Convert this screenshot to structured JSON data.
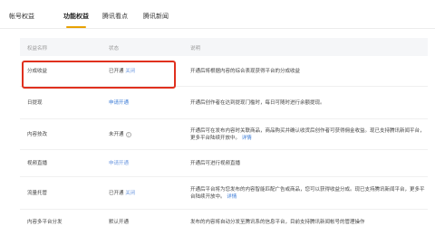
{
  "tabs": [
    {
      "label": "帐号权益"
    },
    {
      "label": "功能权益"
    },
    {
      "label": "腾讯看点"
    },
    {
      "label": "腾讯新闻"
    }
  ],
  "table": {
    "headers": {
      "name": "权益名称",
      "status": "状态",
      "desc": "说明"
    },
    "rows": [
      {
        "name": "分成收益",
        "status": "已开通",
        "action": "关闭",
        "desc": "开通后将根据内容的综合表现获得平台的分成收益"
      },
      {
        "name": "日提现",
        "status": "",
        "action": "申请开通",
        "desc": "开通后创作者在达到提现门槛时，每日可随时进行余额提现。"
      },
      {
        "name": "内容技改",
        "status": "未开通",
        "action": "",
        "desc": "开通后可在发布内容时关联商品，商品购买并确认收货后创作者可获得佣金收益。现已支持腾讯新闻平台，更多平台陆续开放中。",
        "desc_link": "详情"
      },
      {
        "name": "视频直播",
        "status": "",
        "action": "申请开通",
        "desc": "开通后可进行视频直播"
      },
      {
        "name": "流量托管",
        "status": "已开通",
        "action": "关闭",
        "desc": "开通后平台将为您发布的内容智能匹配广告或商品，您可以获得收益分成。现已支持腾讯新闻平台，更多平台陆续开放中。",
        "desc_link": "详情"
      },
      {
        "name": "内容多平台分发",
        "status": "默认开通",
        "action": "",
        "desc": "发布的内容将自动分发至腾讯系的信息平台，目前支持腾讯新闻帐号的管理操作"
      }
    ]
  }
}
